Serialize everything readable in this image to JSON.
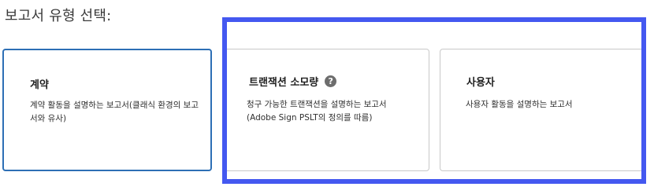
{
  "heading": "보고서 유형 선택:",
  "cards": [
    {
      "title": "계약",
      "description": "계약 활동을 설명하는 보고서(클래식 환경의 보고서와 유사)"
    },
    {
      "title": "트랜잭션 소모량",
      "description": "청구 가능한 트랜잭션을 설명하는 보고서 (Adobe Sign PSLT의 정의를 따름)",
      "help_icon": "?"
    },
    {
      "title": "사용자",
      "description": "사용자 활동을 설명하는 보고서"
    }
  ],
  "colors": {
    "selected_border": "#2d6fb5",
    "highlight_box": "#4458f0",
    "card_border": "#c9c9c9"
  }
}
